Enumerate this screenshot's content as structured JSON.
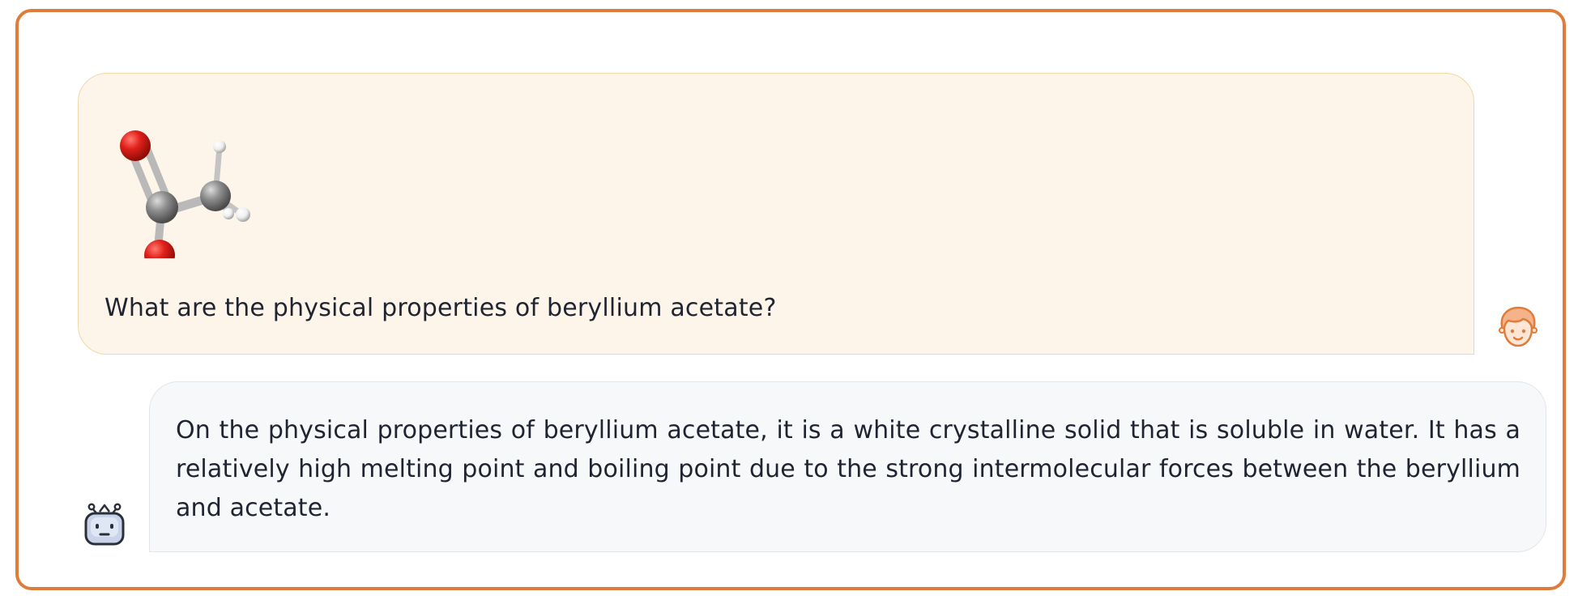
{
  "conversation": {
    "user_message": {
      "attachment_icon": "acetic-acid-molecule-icon",
      "text": "What are the physical properties of beryllium acetate?"
    },
    "assistant_message": {
      "text": "On the physical properties of beryllium acetate, it is a white crystalline solid that is soluble in water. It has a relatively high melting point and boiling point due to the strong intermolecular forces between the beryllium and acetate."
    }
  },
  "avatars": {
    "user_icon": "user-face-icon",
    "assistant_icon": "robot-icon"
  },
  "colors": {
    "frame_border": "#e07c3a",
    "user_bubble_bg": "#fdf5ea",
    "user_bubble_border": "#f1d8a8",
    "assistant_bubble_bg": "#f7f8fa",
    "assistant_bubble_border": "#e2e5ea",
    "oxygen": "#e0201a",
    "carbon": "#8e8e8e",
    "hydrogen": "#f2f2f2"
  }
}
